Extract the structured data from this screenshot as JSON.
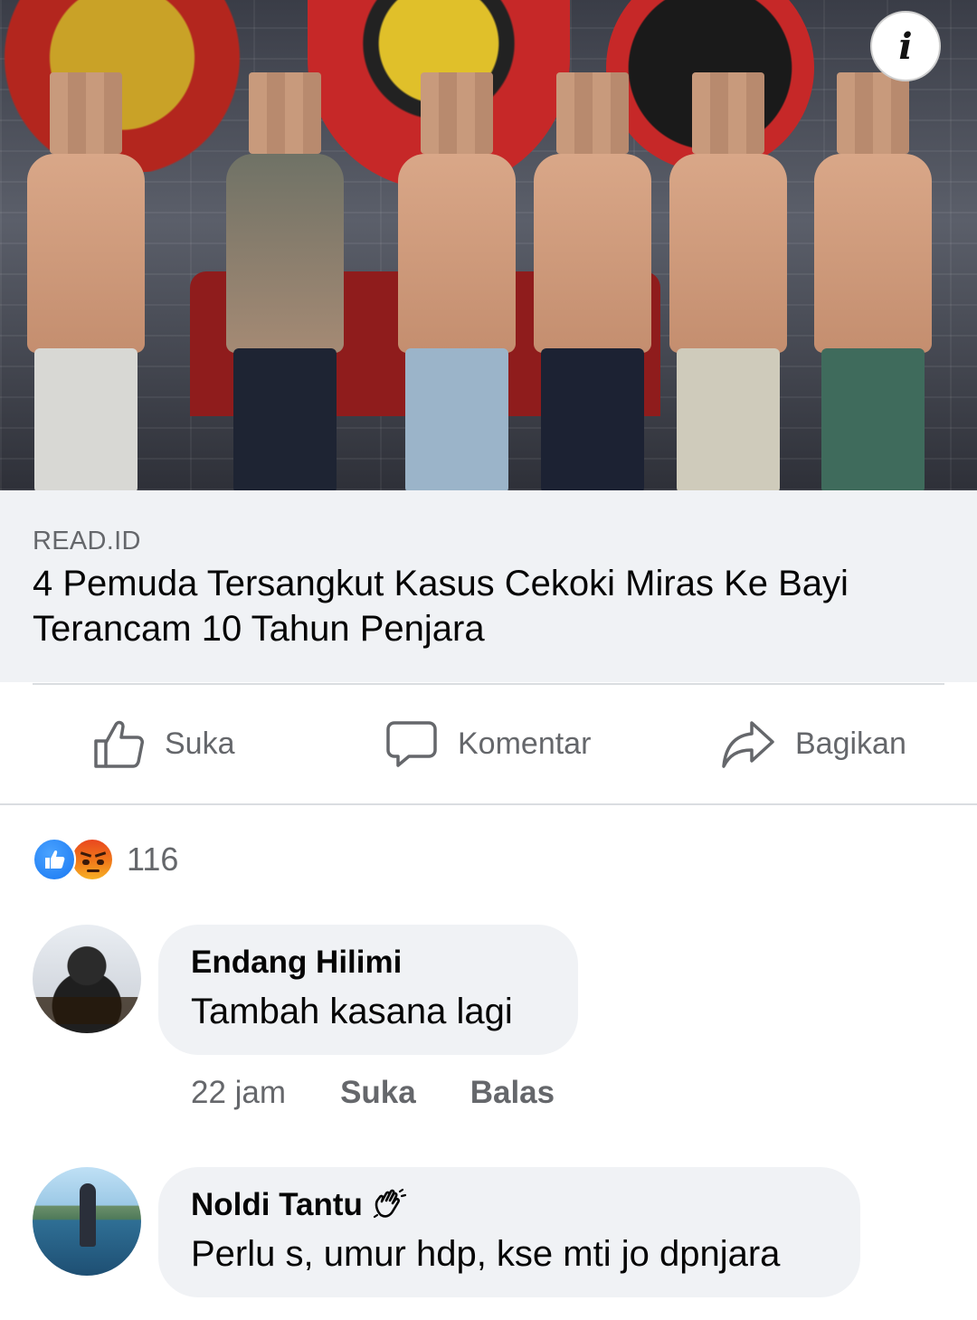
{
  "post": {
    "link": {
      "source": "READ.ID",
      "title": "4 Pemuda Tersangkut Kasus Cekoki Miras Ke Bayi Terancam 10 Tahun Penjara"
    },
    "info_button": "i"
  },
  "actions": {
    "like": "Suka",
    "comment": "Komentar",
    "share": "Bagikan"
  },
  "reactions": {
    "count": "116",
    "types": [
      "like",
      "angry"
    ]
  },
  "comments": [
    {
      "author": "Endang Hilimi",
      "text": "Tambah kasana lagi",
      "time": "22 jam",
      "like_label": "Suka",
      "reply_label": "Balas"
    },
    {
      "author": "Noldi Tantu",
      "text": "Perlu s, umur hdp, kse mti jo dpnjara"
    }
  ],
  "colors": {
    "secondary_text": "#65676b",
    "bubble_bg": "#f0f2f5",
    "like_blue": "#1877f2"
  }
}
